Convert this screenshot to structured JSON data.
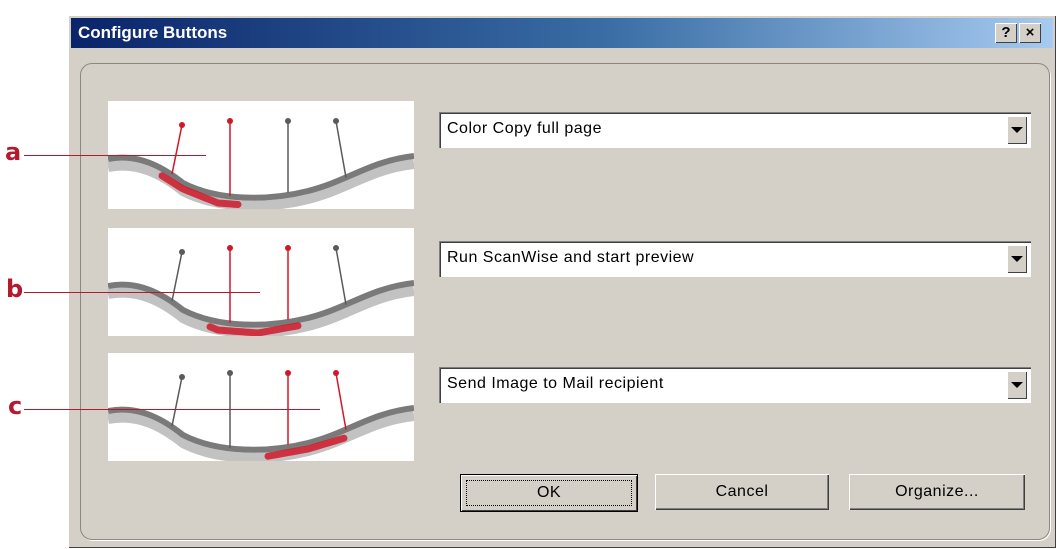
{
  "dialog": {
    "title": "Configure Buttons",
    "help_glyph": "?",
    "close_glyph": "×"
  },
  "callouts": [
    "a",
    "b",
    "c"
  ],
  "rows": [
    {
      "action": "Color Copy full page",
      "active_pins": [
        0,
        1
      ]
    },
    {
      "action": "Run ScanWise and start preview",
      "active_pins": [
        1,
        2
      ]
    },
    {
      "action": "Send Image to Mail recipient",
      "active_pins": [
        2,
        3
      ]
    }
  ],
  "buttons": {
    "ok": "OK",
    "cancel": "Cancel",
    "organize": "Organize..."
  },
  "colors": {
    "title_gradient_start": "#0a246a",
    "title_gradient_end": "#a6caf0",
    "dialog_face": "#d4d0c8",
    "callout_red": "#b4192e",
    "active_pin": "#d01828",
    "inactive_pin": "#5a5a5a"
  },
  "icons": {
    "help": "question-mark-icon",
    "close": "close-icon",
    "dropdown": "chevron-down-icon"
  }
}
